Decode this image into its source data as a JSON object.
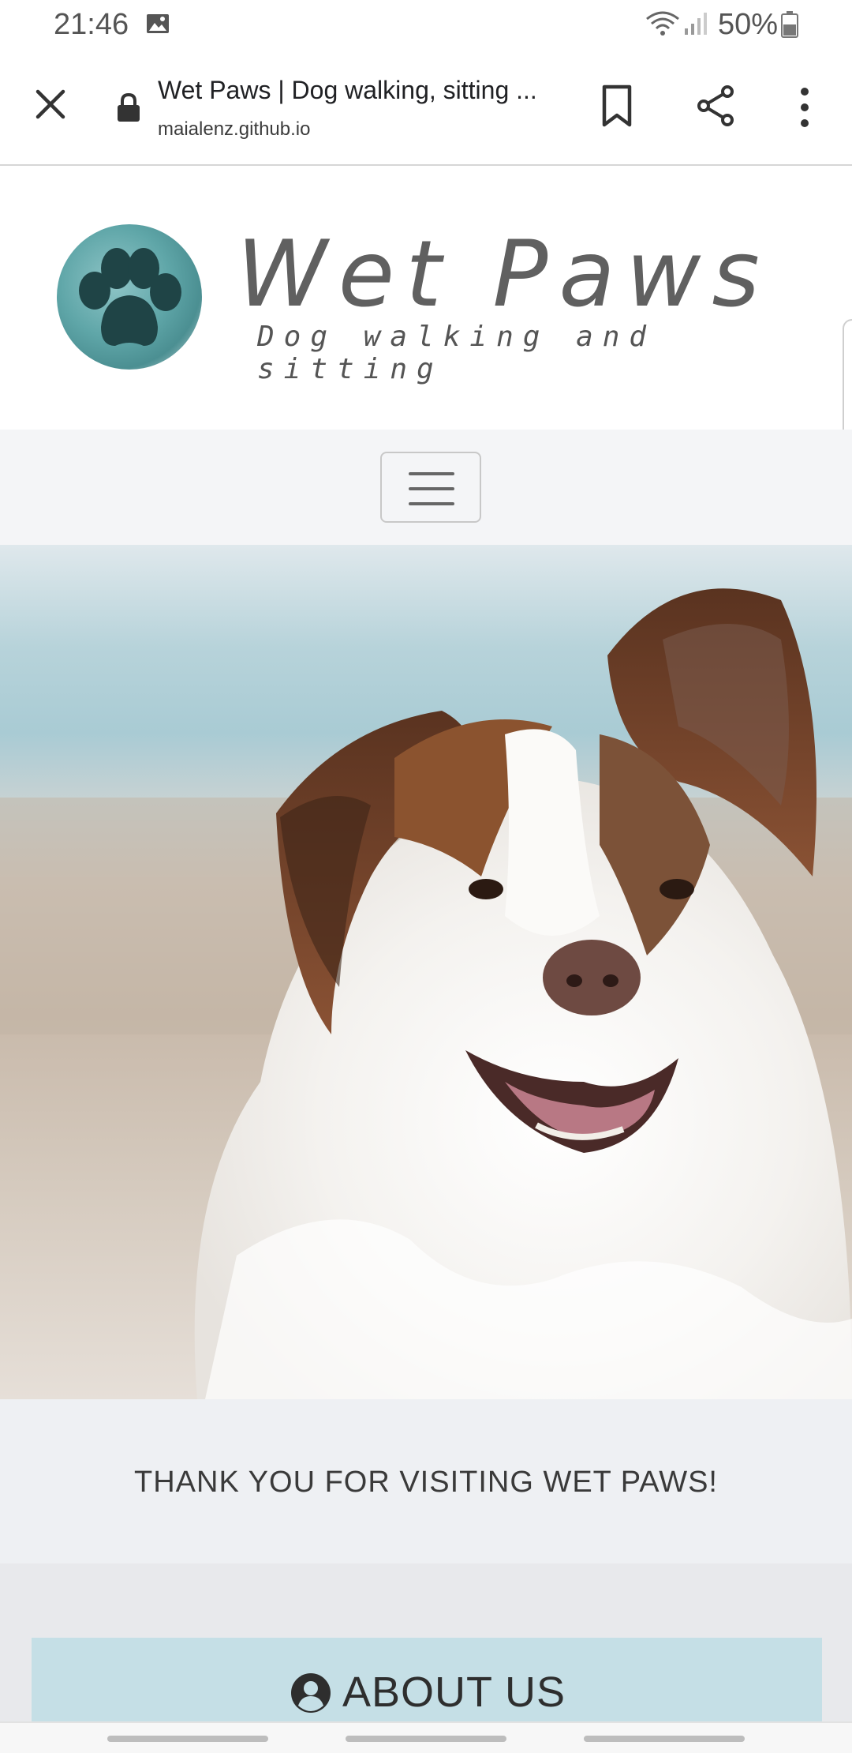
{
  "status_bar": {
    "time": "21:46",
    "battery": "50%",
    "icons": [
      "gallery-icon",
      "wifi-icon",
      "signal-icon",
      "battery-icon"
    ]
  },
  "browser": {
    "page_title": "Wet Paws | Dog walking, sitting ...",
    "url": "maialenz.github.io",
    "icons": [
      "close-icon",
      "lock-icon",
      "bookmark-icon",
      "share-icon",
      "more-vert-icon"
    ]
  },
  "header": {
    "logo_title": "Wet Paws",
    "logo_subtitle": "Dog walking and sitting",
    "logo_icon": "paw-icon"
  },
  "nav": {
    "toggle_icon": "hamburger-icon"
  },
  "hero": {
    "image": "dog-photo"
  },
  "thanks": {
    "text": "THANK YOU FOR VISITING WET PAWS!"
  },
  "about": {
    "title": "ABOUT US",
    "icon": "user-circle-icon"
  },
  "colors": {
    "accent": "#c5dfe6",
    "logo_teal": "#5fa6a8",
    "paw_dark": "#1f4446",
    "section_bg": "#eef0f3"
  }
}
